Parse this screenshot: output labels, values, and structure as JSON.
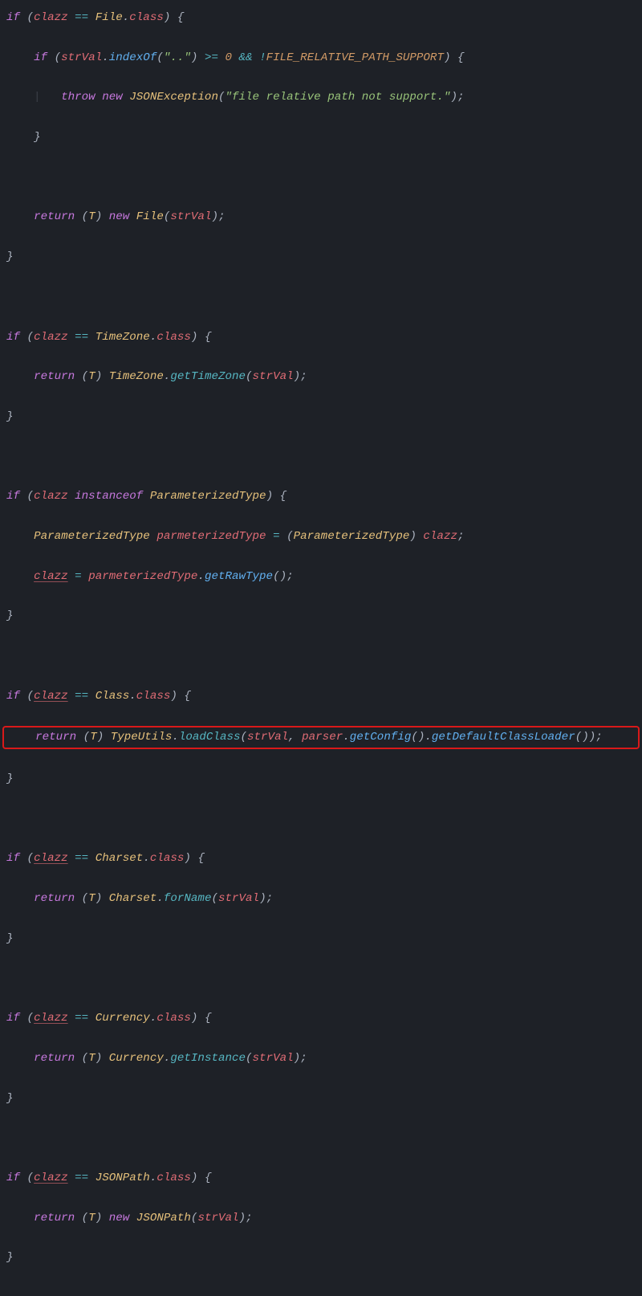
{
  "code": {
    "fileBlock": {
      "ifOpen": "if (clazz == File.class) {",
      "innerIfOpen": "if (strVal.indexOf(\"..\") >= 0 && !FILE_RELATIVE_PATH_SUPPORT) {",
      "throwLine": "throw new JSONException(\"file relative path not support.\");",
      "innerClose": "}",
      "blank": "",
      "returnLine": "return (T) new File(strVal);",
      "close": "}"
    },
    "timezoneBlock": {
      "ifOpen": "if (clazz == TimeZone.class) {",
      "returnLine": "return (T) TimeZone.getTimeZone(strVal);",
      "close": "}"
    },
    "paramTypeBlock": {
      "ifOpen": "if (clazz instanceof ParameterizedType) {",
      "line1": "ParameterizedType parmeterizedType = (ParameterizedType) clazz;",
      "line2": "clazz = parmeterizedType.getRawType();",
      "close": "}"
    },
    "classBlock": {
      "ifOpen": "if (clazz == Class.class) {",
      "returnLine": "return (T) TypeUtils.loadClass(strVal, parser.getConfig().getDefaultClassLoader());",
      "close": "}"
    },
    "charsetBlock": {
      "ifOpen": "if (clazz == Charset.class) {",
      "returnLine": "return (T) Charset.forName(strVal);",
      "close": "}"
    },
    "currencyBlock": {
      "ifOpen": "if (clazz == Currency.class) {",
      "returnLine": "return (T) Currency.getInstance(strVal);",
      "close": "}"
    },
    "jsonpathBlock": {
      "ifOpen": "if (clazz == JSONPath.class) {",
      "returnLine": "return (T) new JSONPath(strVal);",
      "close": "}"
    }
  },
  "raw": {
    "void": ""
  },
  "colors": {
    "background": "#1e2127",
    "highlightBorder": "#d91919",
    "keyword": "#c678dd",
    "class": "#e5c07b",
    "variable": "#e06c75",
    "method": "#61afef",
    "methodStatic": "#56b6c2",
    "string": "#98c379",
    "number": "#d19a66",
    "operator": "#56b6c2",
    "punctuation": "#abb2bf",
    "constant": "#d19a66"
  }
}
